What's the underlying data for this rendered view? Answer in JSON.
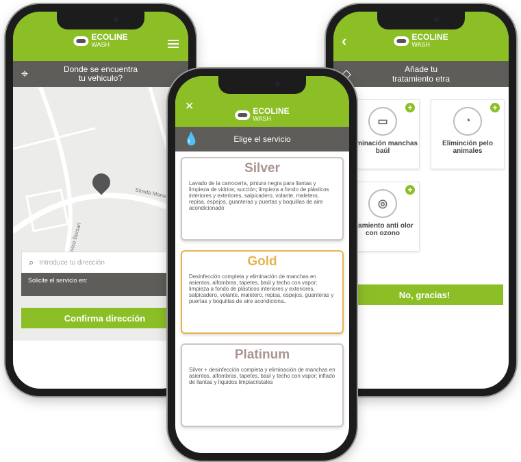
{
  "brand": {
    "name": "ECOLINE",
    "sub": "WASH"
  },
  "screen_left": {
    "bar_title": "Donde se encuentra tu vehiculo?",
    "map_label_1": "Strada Mana",
    "map_label_2": "odovico Borsari",
    "search_placeholder": "Introduce tu dirección",
    "solicite": "Solicite el servicio en:",
    "confirm_button": "Confirma dirección"
  },
  "screen_center": {
    "bar_title": "Elige el servicio",
    "services": [
      {
        "name": "Silver",
        "desc": "Lavado de la carrocería, pintura negra para llantas y limpieza de vidrios; succión; limpieza a fondo de plásticos interiores y exteriores, salpicadero, volante, maletero, repisa, espejos, guanteras y puertas y boquillas de aire acondicionado"
      },
      {
        "name": "Gold",
        "desc": "Desinfección completa y eliminación de manchas en asientos, alfombras, tapetes, baúl y techo con vapor; limpieza a fondo de plásticos interiores y exteriores, salpicadero, volante, maletero, repisa, espejos, guanteras y puertas y boquillas de aire acondiciona.."
      },
      {
        "name": "Platinum",
        "desc": "Silver + desinfección completa y eliminación de manchas en asientos, alfombras, tapetes, baúl y techo con vapor; inflado de llantas y líquidos limpiacristales"
      }
    ]
  },
  "screen_right": {
    "bar_title": "Añade tu tratamiento etra",
    "treatments": [
      {
        "label": "Eliminación manchas baúl"
      },
      {
        "label": "Eliminción pelo animales"
      },
      {
        "label": "atamiento anti olor con ozono"
      }
    ],
    "no_button": "No, gracias!"
  },
  "colors": {
    "green": "#8cbf26",
    "gray_bar": "#5f5d59",
    "gold": "#e6b54e",
    "silver": "#a8958f"
  }
}
